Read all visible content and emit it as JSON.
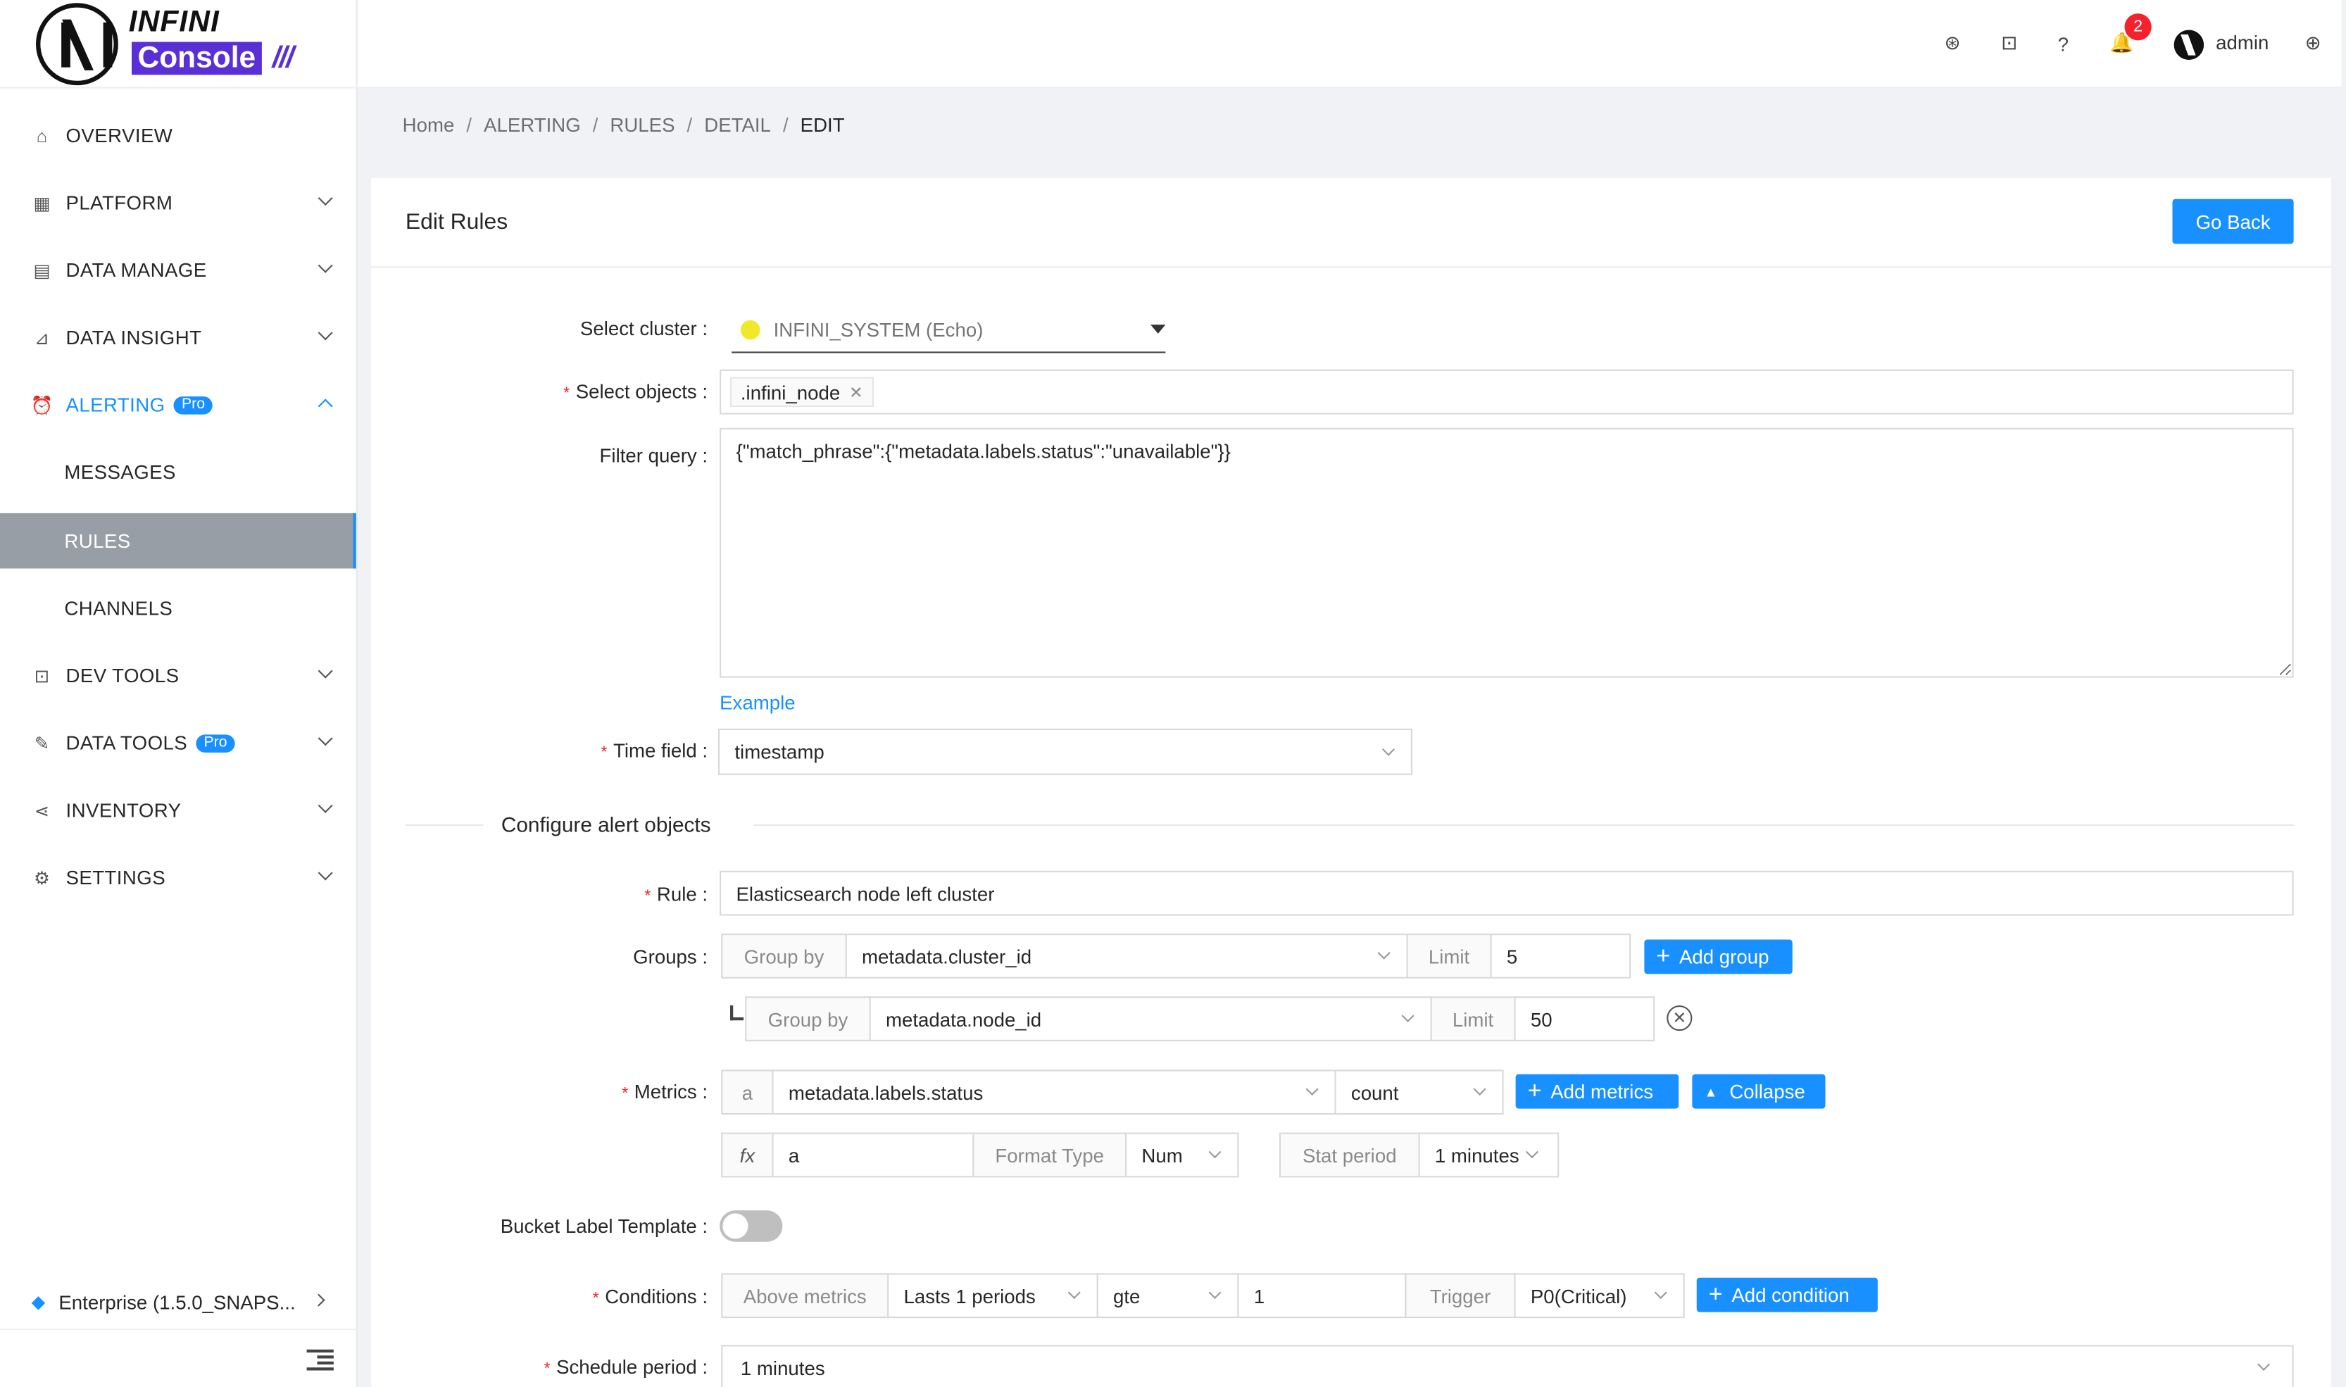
{
  "brand": {
    "top": "INFINI",
    "bottom": "Console",
    "slashes": "///"
  },
  "sidebar": {
    "items": [
      {
        "label": "OVERVIEW",
        "icon": "home-icon"
      },
      {
        "label": "PLATFORM",
        "icon": "platform-icon"
      },
      {
        "label": "DATA MANAGE",
        "icon": "database-icon"
      },
      {
        "label": "DATA INSIGHT",
        "icon": "chart-icon"
      },
      {
        "label": "ALERTING",
        "icon": "alarm-icon",
        "badge": "Pro"
      },
      {
        "label": "MESSAGES"
      },
      {
        "label": "RULES"
      },
      {
        "label": "CHANNELS"
      },
      {
        "label": "DEV TOOLS",
        "icon": "terminal-icon"
      },
      {
        "label": "DATA TOOLS",
        "icon": "wrench-icon",
        "badge": "Pro"
      },
      {
        "label": "INVENTORY",
        "icon": "share-icon"
      },
      {
        "label": "SETTINGS",
        "icon": "gear-icon"
      }
    ],
    "enterprise": "Enterprise (1.5.0_SNAPS..."
  },
  "header": {
    "username": "admin",
    "notification_count": "2"
  },
  "breadcrumb": [
    "Home",
    "ALERTING",
    "RULES",
    "DETAIL",
    "EDIT"
  ],
  "breadcrumb_sep": "/",
  "card": {
    "title": "Edit Rules",
    "go_back": "Go Back"
  },
  "form": {
    "cluster_label": "Select cluster",
    "cluster_value": "INFINI_SYSTEM (Echo)",
    "objects_label": "Select objects",
    "objects_tag": ".infini_node",
    "filter_label": "Filter query",
    "filter_value": "{\"match_phrase\":{\"metadata.labels.status\":\"unavailable\"}}",
    "example_link": "Example",
    "time_label": "Time field",
    "time_value": "timestamp",
    "section_title": "Configure alert objects",
    "rule_label": "Rule",
    "rule_value": "Elasticsearch node left cluster",
    "groups_label": "Groups",
    "group_by": "Group by",
    "limit": "Limit",
    "group1_field": "metadata.cluster_id",
    "group1_limit": "5",
    "group2_field": "metadata.node_id",
    "group2_limit": "50",
    "add_group": "Add group",
    "metrics_label": "Metrics",
    "metric_var": "a",
    "metric_field": "metadata.labels.status",
    "metric_agg": "count",
    "add_metrics": "Add metrics",
    "collapse": "Collapse",
    "fx": "fx",
    "formula": "a",
    "format_type": "Format Type",
    "format_value": "Num",
    "stat_period": "Stat period",
    "stat_value": "1 minutes",
    "bucket_label": "Bucket Label Template",
    "conditions_label": "Conditions",
    "above_metrics": "Above metrics",
    "periods": "Lasts 1 periods",
    "operator": "gte",
    "threshold": "1",
    "trigger": "Trigger",
    "priority": "P0(Critical)",
    "add_condition": "Add condition",
    "schedule_label": "Schedule period",
    "schedule_value": "1 minutes"
  },
  "colors": {
    "primary": "#1890ff",
    "selected_bg": "#989ea6",
    "brand_purple": "#5a2fd6",
    "danger": "#f5222d"
  }
}
